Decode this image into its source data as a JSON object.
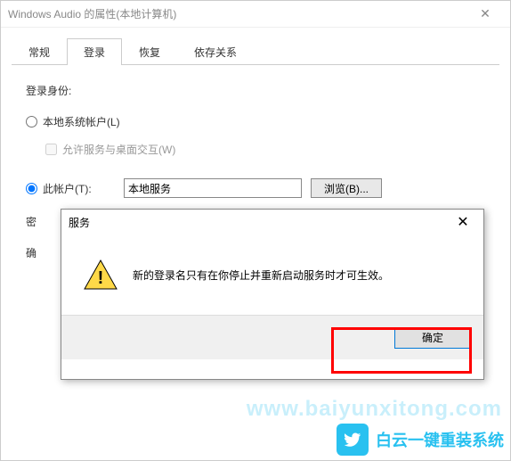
{
  "window": {
    "title": "Windows Audio 的属性(本地计算机)"
  },
  "tabs": {
    "items": [
      {
        "label": "常规"
      },
      {
        "label": "登录"
      },
      {
        "label": "恢复"
      },
      {
        "label": "依存关系"
      }
    ],
    "active_index": 1
  },
  "logon": {
    "section_label": "登录身份:",
    "local_system_label": "本地系统帐户(L)",
    "allow_interact_label": "允许服务与桌面交互(W)",
    "this_account_label": "此帐户(T):",
    "account_value": "本地服务",
    "browse_label": "浏览(B)...",
    "password_label_partial": "密",
    "confirm_label_partial": "确"
  },
  "modal": {
    "title": "服务",
    "message": "新的登录名只有在你停止并重新启动服务时才可生效。",
    "ok_label": "确定"
  },
  "watermark": {
    "text": "白云一键重装系统",
    "url": "www.baiyunxitong.com"
  }
}
